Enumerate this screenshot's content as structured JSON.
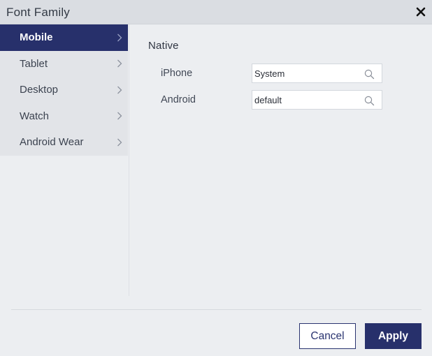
{
  "dialog": {
    "title": "Font Family",
    "close_icon": "close-icon"
  },
  "sidebar": {
    "items": [
      {
        "label": "Mobile",
        "active": true
      },
      {
        "label": "Tablet",
        "active": false
      },
      {
        "label": "Desktop",
        "active": false
      },
      {
        "label": "Watch",
        "active": false
      },
      {
        "label": "Android Wear",
        "active": false
      }
    ]
  },
  "main": {
    "section_title": "Native",
    "fields": [
      {
        "label": "iPhone",
        "value": "System",
        "icon": "search-icon"
      },
      {
        "label": "Android",
        "value": "default",
        "icon": "search-icon"
      }
    ]
  },
  "footer": {
    "cancel_label": "Cancel",
    "apply_label": "Apply"
  },
  "colors": {
    "accent": "#27306b",
    "titlebar": "#dadde2",
    "background": "#eceef1"
  }
}
